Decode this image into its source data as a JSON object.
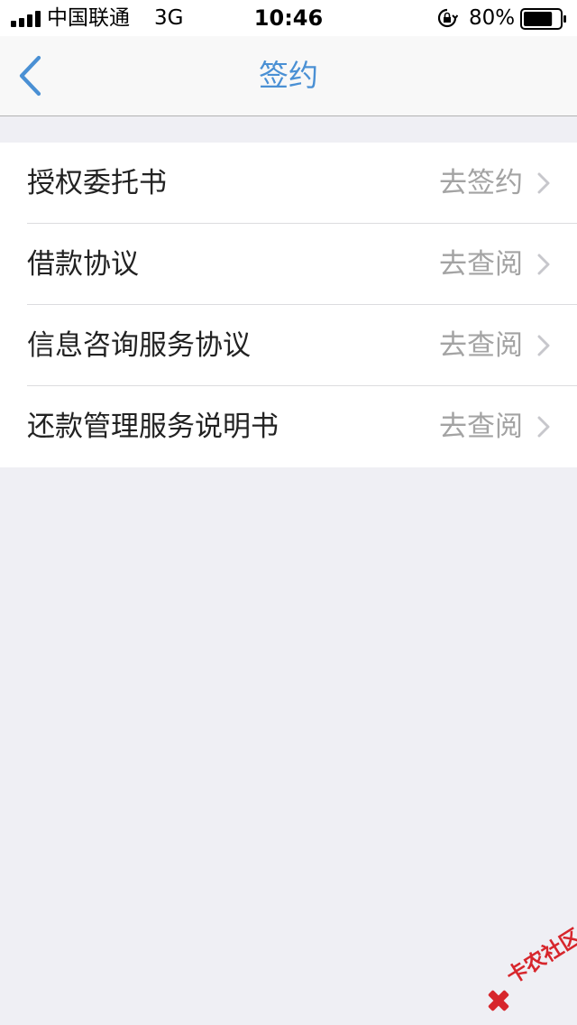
{
  "status_bar": {
    "carrier": "中国联通",
    "network": "3G",
    "time": "10:46",
    "battery_percent": "80%",
    "battery_level": 0.8,
    "icons": [
      "signal-icon",
      "orientation-lock-icon",
      "battery-icon"
    ]
  },
  "nav": {
    "title": "签约",
    "back_icon": "chevron-left-icon",
    "accent_color": "#4a90d4"
  },
  "list": {
    "items": [
      {
        "label": "授权委托书",
        "action": "去签约"
      },
      {
        "label": "借款协议",
        "action": "去查阅"
      },
      {
        "label": "信息咨询服务协议",
        "action": "去查阅"
      },
      {
        "label": "还款管理服务说明书",
        "action": "去查阅"
      }
    ],
    "chevron_icon": "chevron-right-icon"
  },
  "watermark": {
    "text": "卡农社区",
    "color": "#d7262c"
  }
}
